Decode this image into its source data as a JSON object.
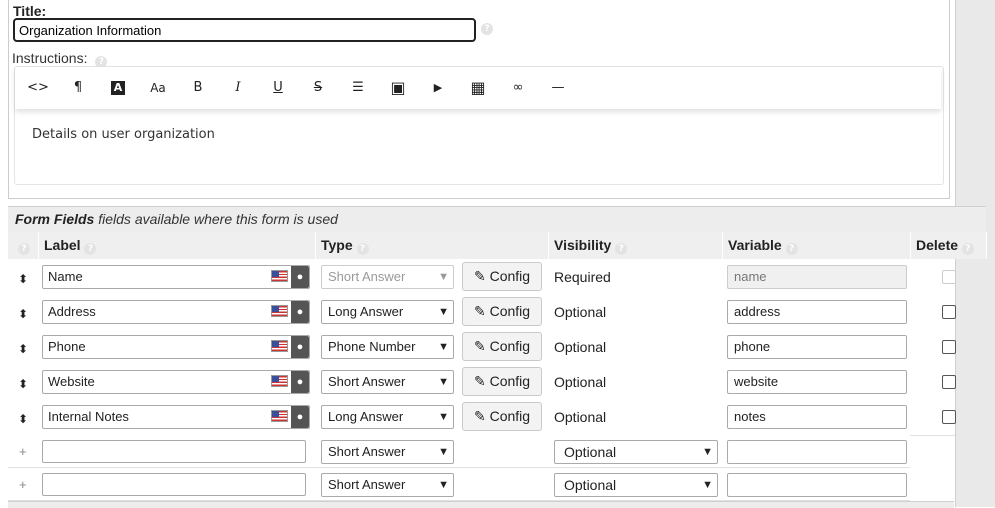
{
  "title_label": "Title:",
  "title_value": "Organization Information",
  "instructions_label": "Instructions:",
  "toolbar": [
    {
      "name": "code-view-icon",
      "glyph": "<>"
    },
    {
      "name": "paragraph-icon",
      "glyph": "¶"
    },
    {
      "name": "text-color-icon",
      "glyph": "A"
    },
    {
      "name": "font-size-icon",
      "glyph": "Aa"
    },
    {
      "name": "bold-icon",
      "glyph": "B"
    },
    {
      "name": "italic-icon",
      "glyph": "I"
    },
    {
      "name": "underline-icon",
      "glyph": "U"
    },
    {
      "name": "strikethrough-icon",
      "glyph": "S"
    },
    {
      "name": "list-icon",
      "glyph": "☰"
    },
    {
      "name": "image-icon",
      "glyph": "▣"
    },
    {
      "name": "video-icon",
      "glyph": "▶"
    },
    {
      "name": "table-icon",
      "glyph": "▦"
    },
    {
      "name": "link-icon",
      "glyph": "∞"
    },
    {
      "name": "horizontal-rule-icon",
      "glyph": "—"
    }
  ],
  "instructions_text": "Details on user organization",
  "form_fields": {
    "heading": "Form Fields",
    "subheading": "fields available where this form is used",
    "columns": {
      "label": "Label",
      "type": "Type",
      "visibility": "Visibility",
      "variable": "Variable",
      "delete": "Delete"
    },
    "config_label": "Config",
    "rows": [
      {
        "label": "Name",
        "type": "Short Answer",
        "visibility": "Required",
        "variable": "name",
        "locked": true
      },
      {
        "label": "Address",
        "type": "Long Answer",
        "visibility": "Optional",
        "variable": "address",
        "locked": false
      },
      {
        "label": "Phone",
        "type": "Phone Number",
        "visibility": "Optional",
        "variable": "phone",
        "locked": false
      },
      {
        "label": "Website",
        "type": "Short Answer",
        "visibility": "Optional",
        "variable": "website",
        "locked": false
      },
      {
        "label": "Internal Notes",
        "type": "Long Answer",
        "visibility": "Optional",
        "variable": "notes",
        "locked": false
      }
    ],
    "new_rows": [
      {
        "type": "Short Answer",
        "visibility": "Optional"
      },
      {
        "type": "Short Answer",
        "visibility": "Optional"
      }
    ]
  }
}
